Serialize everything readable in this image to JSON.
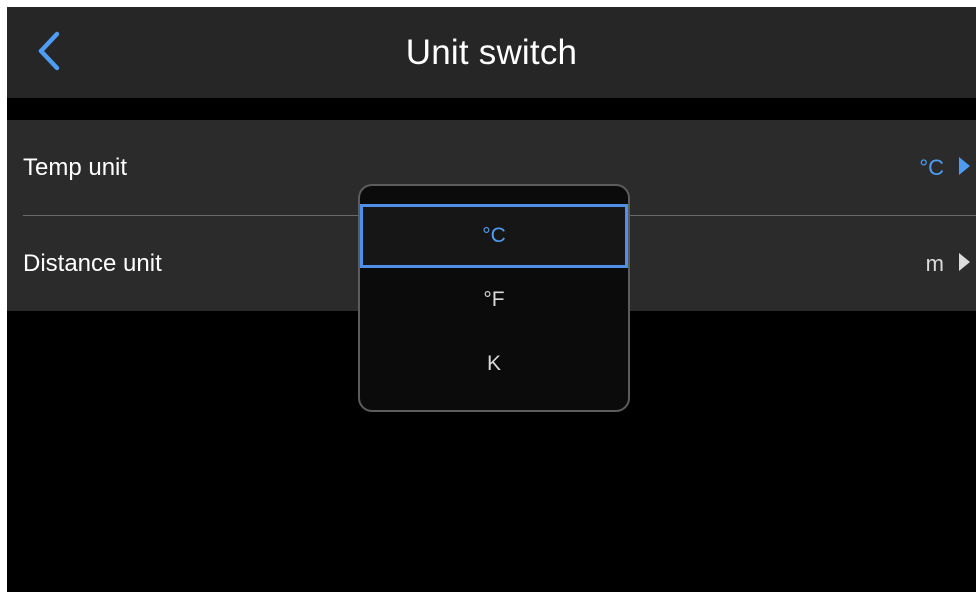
{
  "header": {
    "title": "Unit switch",
    "back_icon": "chevron-left-icon"
  },
  "colors": {
    "accent": "#4f9cf4",
    "header_bg": "#262626",
    "panel_bg": "#2b2b2b",
    "screen_bg": "#000000"
  },
  "settings": {
    "rows": [
      {
        "label": "Temp unit",
        "value": "°C",
        "highlighted": true
      },
      {
        "label": "Distance unit",
        "value": "m",
        "highlighted": false
      }
    ]
  },
  "dropdown": {
    "selected": "°C",
    "options": [
      {
        "label": "°C"
      },
      {
        "label": "°F"
      },
      {
        "label": "K"
      }
    ]
  }
}
